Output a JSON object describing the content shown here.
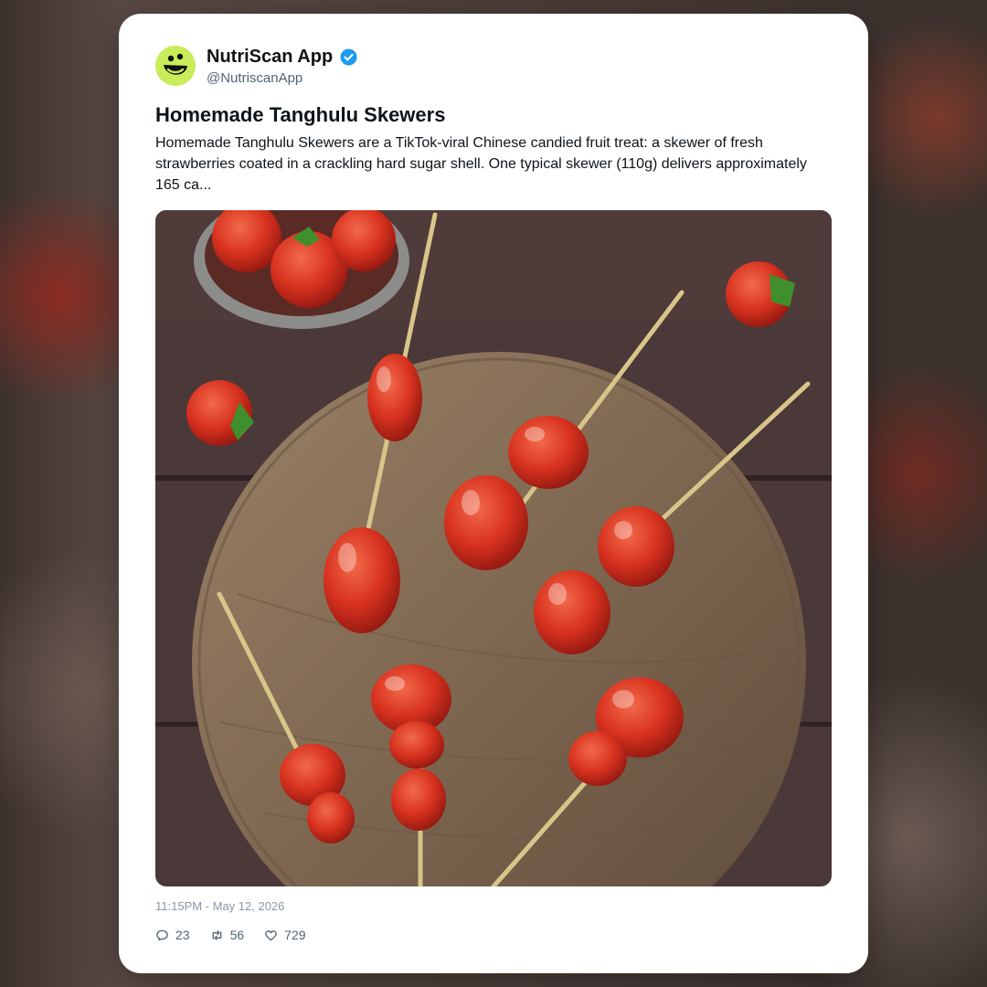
{
  "post": {
    "account_name": "NutriScan App",
    "handle": "@NutriscanApp",
    "verified_icon": "verified-badge-icon",
    "title": "Homemade Tanghulu Skewers",
    "body": "Homemade Tanghulu Skewers are a TikTok-viral Chinese candied fruit treat: a skewer of fresh strawberries coated in a crackling hard sugar shell. One typical skewer (110g) delivers approximately 165 ca...",
    "timestamp": "11:15PM - May 12, 2026",
    "replies": "23",
    "reposts": "56",
    "likes": "729"
  },
  "colors": {
    "avatar_bg": "#c9ec5a",
    "verified": "#1d9bf0",
    "text_primary": "#0f1419",
    "text_secondary": "#536471"
  },
  "icons": {
    "reply": "speech-bubble-icon",
    "repost": "repost-arrows-icon",
    "like": "heart-icon"
  }
}
